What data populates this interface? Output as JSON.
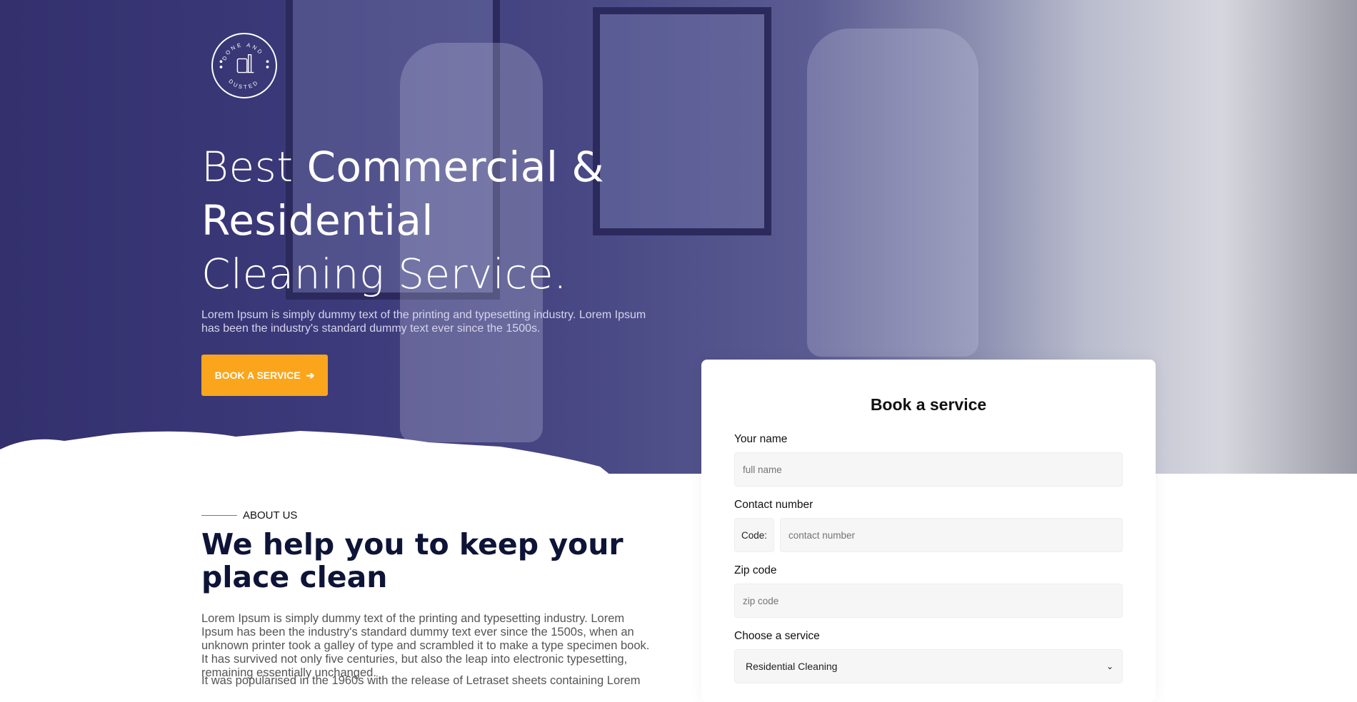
{
  "logo": {
    "text_top": "DONE AND",
    "text_bottom": "DUSTED"
  },
  "hero": {
    "title_line1_light": "Best ",
    "title_line1_bold": "Commercial &",
    "title_line2_bold": "Residential",
    "title_line3_light": "Cleaning Service.",
    "subtitle": "Lorem Ipsum is simply dummy text of the printing and typesetting industry. Lorem Ipsum has been the industry's standard dummy text ever since the 1500s.",
    "cta_label": "BOOK A SERVICE"
  },
  "about": {
    "label": "ABOUT US",
    "heading": "We help you to keep your place clean",
    "paragraph": "Lorem Ipsum is simply dummy text of the printing and typesetting industry. Lorem Ipsum has been the industry's standard dummy text ever since the 1500s, when an unknown printer took a galley of type and scrambled it to make a type specimen book. It has survived not only five centuries, but also the leap into electronic typesetting, remaining essentially unchanged.",
    "paragraph2": "It was popularised in the 1960s with the release of Letraset sheets containing Lorem"
  },
  "form": {
    "title": "Book a service",
    "name_label": "Your name",
    "name_placeholder": "full name",
    "contact_label": "Contact number",
    "code_label": "Code:",
    "contact_placeholder": "contact number",
    "zip_label": "Zip code",
    "zip_placeholder": "zip code",
    "service_label": "Choose a service",
    "service_value": "Residential Cleaning"
  },
  "colors": {
    "accent": "#fba51c",
    "heading": "#0d1437",
    "hero_overlay": "#3c3a7a"
  }
}
